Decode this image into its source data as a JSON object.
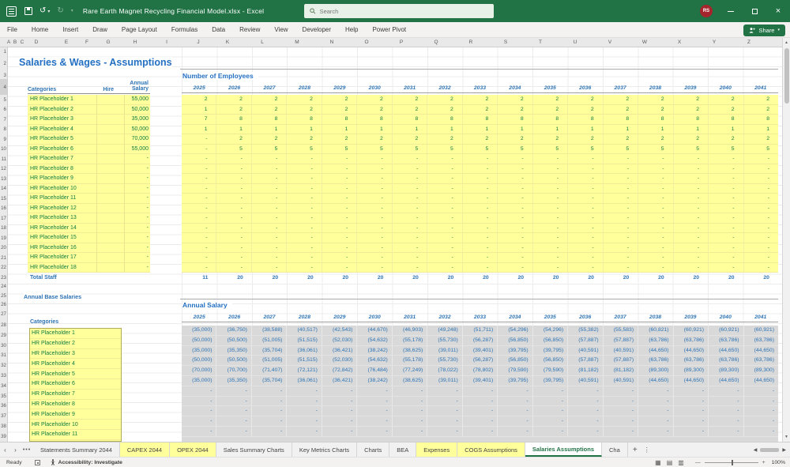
{
  "colors": {
    "titlebar_green": "#217346",
    "accent_blue": "#2e74b5",
    "heading_blue": "#2470c2",
    "input_yellow": "#ffff9c",
    "input_text_green": "#107c41",
    "table_gray": "#d9d9d9",
    "avatar_red": "#a4262c",
    "active_tab_green": "#217346"
  },
  "titlebar": {
    "title": "Rare Earth Magnet Recycling Financial Model.xlsx - Excel",
    "search_placeholder": "Search",
    "avatar_initials": "RS",
    "undo_glyph": "↺",
    "redo_glyph": "↻",
    "minimize": "–",
    "close_glyph": "×"
  },
  "ribbon": {
    "tabs": [
      "File",
      "Home",
      "Insert",
      "Draw",
      "Page Layout",
      "Formulas",
      "Data",
      "Review",
      "View",
      "Developer",
      "Help",
      "Power Pivot"
    ],
    "share_label": "Share",
    "share_caret": "▾"
  },
  "grid": {
    "column_letters": [
      "A",
      "B",
      "C",
      "D",
      "E",
      "F",
      "G",
      "H",
      "I",
      "J",
      "K",
      "L",
      "M",
      "N",
      "O",
      "P",
      "Q",
      "R",
      "S",
      "T",
      "U",
      "V",
      "W",
      "X",
      "Y",
      "Z"
    ],
    "row_numbers": [
      1,
      2,
      3,
      4,
      5,
      6,
      7,
      8,
      9,
      10,
      11,
      12,
      13,
      14,
      15,
      16,
      17,
      18,
      19,
      20,
      21,
      22,
      23,
      24,
      25,
      26,
      27,
      28,
      29,
      30,
      31,
      32,
      33,
      34,
      35,
      36,
      37,
      38,
      39
    ]
  },
  "sheet": {
    "title": "Salaries & Wages - Assumptions",
    "staff_table": {
      "col_categories": "Categories",
      "col_hire": "Hire",
      "col_salary": "Annual Salary",
      "total_label": "Total Staff",
      "rows": [
        {
          "category": "HR Placeholder 1",
          "salary": "55,000"
        },
        {
          "category": "HR Placeholder 2",
          "salary": "50,000"
        },
        {
          "category": "HR Placeholder 3",
          "salary": "35,000"
        },
        {
          "category": "HR Placeholder 4",
          "salary": "50,000"
        },
        {
          "category": "HR Placeholder 5",
          "salary": "70,000"
        },
        {
          "category": "HR Placeholder 6",
          "salary": "55,000"
        },
        {
          "category": "HR Placeholder 7",
          "salary": "-"
        },
        {
          "category": "HR Placeholder 8",
          "salary": "-"
        },
        {
          "category": "HR Placeholder 9",
          "salary": "-"
        },
        {
          "category": "HR Placeholder 10",
          "salary": "-"
        },
        {
          "category": "HR Placeholder 11",
          "salary": "-"
        },
        {
          "category": "HR Placeholder 12",
          "salary": "-"
        },
        {
          "category": "HR Placeholder 13",
          "salary": "-"
        },
        {
          "category": "HR Placeholder 14",
          "salary": "-"
        },
        {
          "category": "HR Placeholder 15",
          "salary": "-"
        },
        {
          "category": "HR Placeholder 16",
          "salary": "-"
        },
        {
          "category": "HR Placeholder 17",
          "salary": "-"
        },
        {
          "category": "HR Placeholder 18",
          "salary": "-"
        }
      ]
    },
    "employees_table": {
      "title": "Number of Employees",
      "years": [
        "2025",
        "2026",
        "2027",
        "2028",
        "2029",
        "2030",
        "2031",
        "2032",
        "2033",
        "2034",
        "2035",
        "2036",
        "2037",
        "2038",
        "2039",
        "2040",
        "2041"
      ],
      "rows": [
        [
          "2",
          "2",
          "2",
          "2",
          "2",
          "2",
          "2",
          "2",
          "2",
          "2",
          "2",
          "2",
          "2",
          "2",
          "2",
          "2",
          "2"
        ],
        [
          "1",
          "2",
          "2",
          "2",
          "2",
          "2",
          "2",
          "2",
          "2",
          "2",
          "2",
          "2",
          "2",
          "2",
          "2",
          "2",
          "2"
        ],
        [
          "7",
          "8",
          "8",
          "8",
          "8",
          "8",
          "8",
          "8",
          "8",
          "8",
          "8",
          "8",
          "8",
          "8",
          "8",
          "8",
          "8"
        ],
        [
          "1",
          "1",
          "1",
          "1",
          "1",
          "1",
          "1",
          "1",
          "1",
          "1",
          "1",
          "1",
          "1",
          "1",
          "1",
          "1",
          "1"
        ],
        [
          "-",
          "2",
          "2",
          "2",
          "2",
          "2",
          "2",
          "2",
          "2",
          "2",
          "2",
          "2",
          "2",
          "2",
          "2",
          "2",
          "2"
        ],
        [
          "-",
          "5",
          "5",
          "5",
          "5",
          "5",
          "5",
          "5",
          "5",
          "5",
          "5",
          "5",
          "5",
          "5",
          "5",
          "5",
          "5"
        ],
        [
          "-",
          "-",
          "-",
          "-",
          "-",
          "-",
          "-",
          "-",
          "-",
          "-",
          "-",
          "-",
          "-",
          "-",
          "-",
          "-",
          "-"
        ],
        [
          "-",
          "-",
          "-",
          "-",
          "-",
          "-",
          "-",
          "-",
          "-",
          "-",
          "-",
          "-",
          "-",
          "-",
          "-",
          "-",
          "-"
        ],
        [
          "-",
          "-",
          "-",
          "-",
          "-",
          "-",
          "-",
          "-",
          "-",
          "-",
          "-",
          "-",
          "-",
          "-",
          "-",
          "-",
          "-"
        ],
        [
          "-",
          "-",
          "-",
          "-",
          "-",
          "-",
          "-",
          "-",
          "-",
          "-",
          "-",
          "-",
          "-",
          "-",
          "-",
          "-",
          "-"
        ],
        [
          "-",
          "-",
          "-",
          "-",
          "-",
          "-",
          "-",
          "-",
          "-",
          "-",
          "-",
          "-",
          "-",
          "-",
          "-",
          "-",
          "-"
        ],
        [
          "-",
          "-",
          "-",
          "-",
          "-",
          "-",
          "-",
          "-",
          "-",
          "-",
          "-",
          "-",
          "-",
          "-",
          "-",
          "-",
          "-"
        ],
        [
          "-",
          "-",
          "-",
          "-",
          "-",
          "-",
          "-",
          "-",
          "-",
          "-",
          "-",
          "-",
          "-",
          "-",
          "-",
          "-",
          "-"
        ],
        [
          "-",
          "-",
          "-",
          "-",
          "-",
          "-",
          "-",
          "-",
          "-",
          "-",
          "-",
          "-",
          "-",
          "-",
          "-",
          "-",
          "-"
        ],
        [
          "-",
          "-",
          "-",
          "-",
          "-",
          "-",
          "-",
          "-",
          "-",
          "-",
          "-",
          "-",
          "-",
          "-",
          "-",
          "-",
          "-"
        ],
        [
          "-",
          "-",
          "-",
          "-",
          "-",
          "-",
          "-",
          "-",
          "-",
          "-",
          "-",
          "-",
          "-",
          "-",
          "-",
          "-",
          "-"
        ],
        [
          "-",
          "-",
          "-",
          "-",
          "-",
          "-",
          "-",
          "-",
          "-",
          "-",
          "-",
          "-",
          "-",
          "-",
          "-",
          "-",
          "-"
        ],
        [
          "-",
          "-",
          "-",
          "-",
          "-",
          "-",
          "-",
          "-",
          "-",
          "-",
          "-",
          "-",
          "-",
          "-",
          "-",
          "-",
          "-"
        ]
      ],
      "totals": [
        "11",
        "20",
        "20",
        "20",
        "20",
        "20",
        "20",
        "20",
        "20",
        "20",
        "20",
        "20",
        "20",
        "20",
        "20",
        "20",
        "20"
      ]
    },
    "base_salaries": {
      "heading": "Annual Base Salaries",
      "col_categories": "Categories",
      "categories": [
        "HR Placeholder 1",
        "HR Placeholder 2",
        "HR Placeholder 3",
        "HR Placeholder 4",
        "HR Placeholder 5",
        "HR Placeholder 6",
        "HR Placeholder 7",
        "HR Placeholder 8",
        "HR Placeholder 9",
        "HR Placeholder 10",
        "HR Placeholder 11"
      ]
    },
    "salary_table": {
      "title": "Annual Salary",
      "years": [
        "2025",
        "2026",
        "2027",
        "2028",
        "2029",
        "2030",
        "2031",
        "2032",
        "2033",
        "2034",
        "2035",
        "2036",
        "2037",
        "2038",
        "2039",
        "2040",
        "2041"
      ],
      "rows": [
        [
          "(35,000)",
          "(36,750)",
          "(38,588)",
          "(40,517)",
          "(42,543)",
          "(44,670)",
          "(46,903)",
          "(49,248)",
          "(51,711)",
          "(54,296)",
          "(54,296)",
          "(55,382)",
          "(55,583)",
          "(60,821)",
          "(60,921)",
          "(60,921)",
          "(60,921)"
        ],
        [
          "(50,000)",
          "(50,500)",
          "(51,005)",
          "(51,515)",
          "(52,030)",
          "(54,632)",
          "(55,178)",
          "(55,730)",
          "(56,287)",
          "(56,850)",
          "(56,850)",
          "(57,887)",
          "(57,887)",
          "(63,786)",
          "(63,786)",
          "(63,786)",
          "(63,786)"
        ],
        [
          "(35,000)",
          "(35,350)",
          "(35,704)",
          "(36,061)",
          "(36,421)",
          "(38,242)",
          "(38,625)",
          "(39,011)",
          "(39,401)",
          "(39,795)",
          "(39,795)",
          "(40,591)",
          "(40,591)",
          "(44,650)",
          "(44,650)",
          "(44,650)",
          "(44,650)"
        ],
        [
          "(50,000)",
          "(50,500)",
          "(51,005)",
          "(51,515)",
          "(52,030)",
          "(54,632)",
          "(55,178)",
          "(55,730)",
          "(56,287)",
          "(56,850)",
          "(56,850)",
          "(57,887)",
          "(57,887)",
          "(63,786)",
          "(63,786)",
          "(63,786)",
          "(63,786)"
        ],
        [
          "(70,000)",
          "(70,700)",
          "(71,407)",
          "(72,121)",
          "(72,842)",
          "(76,484)",
          "(77,249)",
          "(78,022)",
          "(78,802)",
          "(79,590)",
          "(79,590)",
          "(81,182)",
          "(81,182)",
          "(89,300)",
          "(89,300)",
          "(89,300)",
          "(89,300)"
        ],
        [
          "(35,000)",
          "(35,350)",
          "(35,704)",
          "(36,061)",
          "(36,421)",
          "(38,242)",
          "(38,625)",
          "(39,011)",
          "(39,401)",
          "(39,795)",
          "(39,795)",
          "(40,591)",
          "(40,591)",
          "(44,650)",
          "(44,650)",
          "(44,650)",
          "(44,650)"
        ],
        [
          "-",
          "-",
          "-",
          "-",
          "-",
          "-",
          "-",
          "-",
          "-",
          "-",
          "-",
          "-",
          "-",
          "-",
          "-",
          "-",
          "-"
        ],
        [
          "-",
          "-",
          "-",
          "-",
          "-",
          "-",
          "-",
          "-",
          "-",
          "-",
          "-",
          "-",
          "-",
          "-",
          "-",
          "-",
          "-"
        ],
        [
          "-",
          "-",
          "-",
          "-",
          "-",
          "-",
          "-",
          "-",
          "-",
          "-",
          "-",
          "-",
          "-",
          "-",
          "-",
          "-",
          "-"
        ],
        [
          "-",
          "-",
          "-",
          "-",
          "-",
          "-",
          "-",
          "-",
          "-",
          "-",
          "-",
          "-",
          "-",
          "-",
          "-",
          "-",
          "-"
        ],
        [
          "-",
          "-",
          "-",
          "-",
          "-",
          "-",
          "-",
          "-",
          "-",
          "-",
          "-",
          "-",
          "-",
          "-",
          "-",
          "-",
          "-"
        ]
      ]
    }
  },
  "sheet_tabs": {
    "tabs": [
      {
        "label": "Statements Summary 2044",
        "style": "normal"
      },
      {
        "label": "CAPEX 2044",
        "style": "yellow"
      },
      {
        "label": "OPEX 2044",
        "style": "yellow"
      },
      {
        "label": "Sales Summary Charts",
        "style": "normal"
      },
      {
        "label": "Key Metrics Charts",
        "style": "normal"
      },
      {
        "label": "Charts",
        "style": "normal"
      },
      {
        "label": "BEA",
        "style": "normal"
      },
      {
        "label": "Expenses",
        "style": "yellow"
      },
      {
        "label": "COGS Assumptions",
        "style": "yellow"
      },
      {
        "label": "Salaries Assumptions",
        "style": "active"
      },
      {
        "label": "Cha",
        "style": "normal"
      }
    ],
    "nav_left": "‹",
    "nav_right": "›",
    "more_tabs": "•••",
    "add_sheet": "+",
    "kebab": "⋮",
    "scroll_left": "◀",
    "scroll_right": "▶"
  },
  "statusbar": {
    "ready": "Ready",
    "accessibility": "Accessibility: Investigate",
    "zoom": "100%",
    "zoom_minus": "—",
    "zoom_plus": "+",
    "view_icons": [
      "▦",
      "▤",
      "▥"
    ]
  }
}
